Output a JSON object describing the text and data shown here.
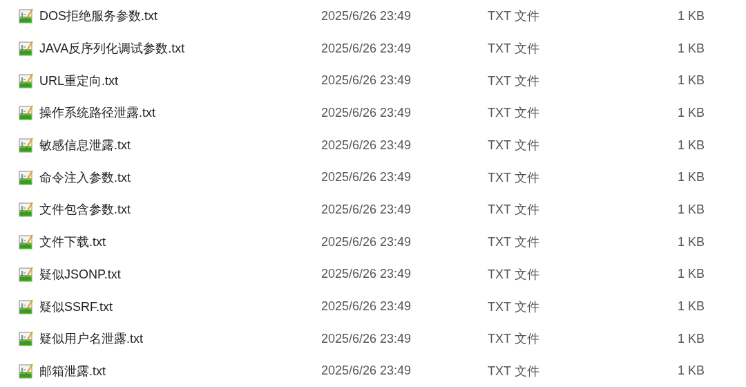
{
  "files": [
    {
      "name": "DOS拒绝服务参数.txt",
      "modified": "2025/6/26 23:49",
      "type": "TXT 文件",
      "size": "1 KB"
    },
    {
      "name": "JAVA反序列化调试参数.txt",
      "modified": "2025/6/26 23:49",
      "type": "TXT 文件",
      "size": "1 KB"
    },
    {
      "name": "URL重定向.txt",
      "modified": "2025/6/26 23:49",
      "type": "TXT 文件",
      "size": "1 KB"
    },
    {
      "name": "操作系统路径泄露.txt",
      "modified": "2025/6/26 23:49",
      "type": "TXT 文件",
      "size": "1 KB"
    },
    {
      "name": "敏感信息泄露.txt",
      "modified": "2025/6/26 23:49",
      "type": "TXT 文件",
      "size": "1 KB"
    },
    {
      "name": "命令注入参数.txt",
      "modified": "2025/6/26 23:49",
      "type": "TXT 文件",
      "size": "1 KB"
    },
    {
      "name": "文件包含参数.txt",
      "modified": "2025/6/26 23:49",
      "type": "TXT 文件",
      "size": "1 KB"
    },
    {
      "name": "文件下载.txt",
      "modified": "2025/6/26 23:49",
      "type": "TXT 文件",
      "size": "1 KB"
    },
    {
      "name": "疑似JSONP.txt",
      "modified": "2025/6/26 23:49",
      "type": "TXT 文件",
      "size": "1 KB"
    },
    {
      "name": "疑似SSRF.txt",
      "modified": "2025/6/26 23:49",
      "type": "TXT 文件",
      "size": "1 KB"
    },
    {
      "name": "疑似用户名泄露.txt",
      "modified": "2025/6/26 23:49",
      "type": "TXT 文件",
      "size": "1 KB"
    },
    {
      "name": "邮箱泄露.txt",
      "modified": "2025/6/26 23:49",
      "type": "TXT 文件",
      "size": "1 KB"
    }
  ]
}
